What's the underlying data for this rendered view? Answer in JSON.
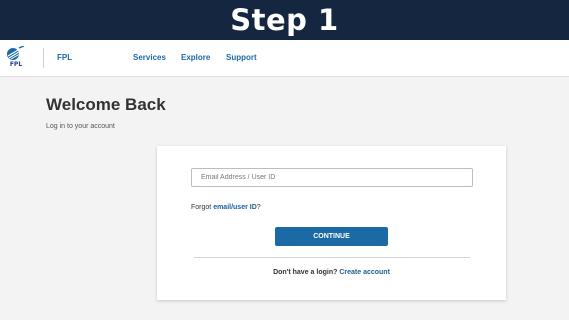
{
  "banner": {
    "title": "Step 1"
  },
  "navbar": {
    "logo_text": "FPL",
    "brand": "FPL",
    "links": [
      "Services",
      "Explore",
      "Support"
    ]
  },
  "page": {
    "title": "Welcome Back",
    "subtitle": "Log in to your account"
  },
  "login": {
    "email_placeholder": "Email Address / User ID",
    "forgot_prefix": "Forgot ",
    "forgot_link": "email/user ID",
    "forgot_suffix": "?",
    "continue_label": "CONTINUE",
    "signup_prefix": "Don't have a login? ",
    "signup_link": "Create account"
  },
  "colors": {
    "banner_bg": "#142640",
    "accent": "#1b6aa5",
    "page_bg": "#f3f3f3"
  }
}
